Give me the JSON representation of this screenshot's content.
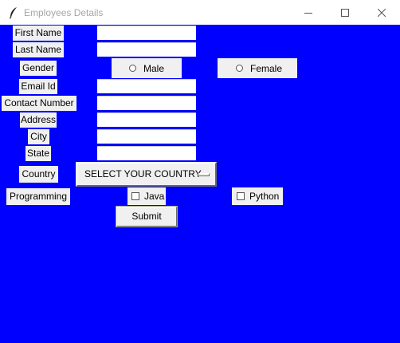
{
  "window": {
    "title": "Employees Details"
  },
  "icons": {
    "app": "feather-icon",
    "minimize": "minimize-icon",
    "maximize": "maximize-icon",
    "close": "close-icon"
  },
  "colors": {
    "background": "#0000ff",
    "widget": "#f0f0f0",
    "entry": "#ffffff"
  },
  "form": {
    "first_name_label": "First Name",
    "last_name_label": "Last Name",
    "gender_label": "Gender",
    "gender_options": [
      "Male",
      "Female"
    ],
    "email_label": "Email Id",
    "contact_label": "Contact Number",
    "address_label": "Address",
    "city_label": "City",
    "state_label": "State",
    "country_label": "Country",
    "country_selected": "SELECT YOUR COUNTRY",
    "programming_label": "Programming",
    "programming_options": [
      "Java",
      "Python"
    ],
    "submit_label": "Submit",
    "values": {
      "first_name": "",
      "last_name": "",
      "email": "",
      "contact": "",
      "address": "",
      "city": "",
      "state": ""
    }
  }
}
